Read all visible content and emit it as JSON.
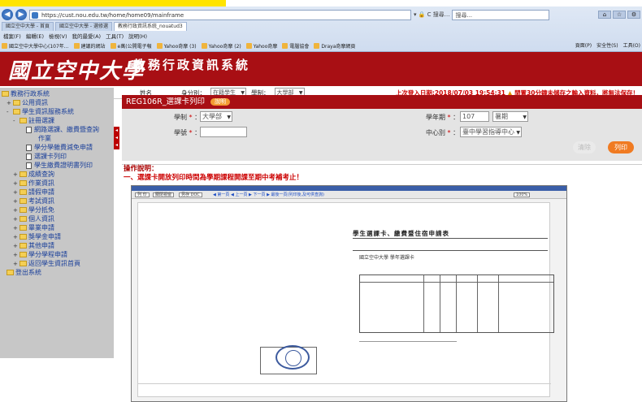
{
  "browser": {
    "address": "https://cust.nou.edu.tw/home/home09/mainframe",
    "address_tools": "▾ 🔒 C  搜尋...",
    "search_placeholder": "搜尋...",
    "tabs": [
      "國立空中大學 - 首頁",
      "國立空中大學 - 選修選",
      "教務行政資訊系統_nouatud3"
    ],
    "menu": [
      "檔案(F)",
      "編輯(E)",
      "檢視(V)",
      "我的最愛(A)",
      "工具(T)",
      "說明(H)"
    ],
    "favorites": [
      "國立空中大學中心(107年...",
      "建議的網站",
      "e萬(公開電子報",
      "Yahoo奇摩 (3)",
      "Yahoo奇摩 (2)",
      "Yahoo奇摩",
      "電腦協會",
      "Draya奇摩網頁"
    ],
    "fav_tools": [
      "頁面(P)",
      "安全性(S)",
      "工具(O)"
    ]
  },
  "header": {
    "logo": "國立空中大學",
    "system_title": "教務行政資訊系統",
    "name_label": "姓名",
    "identity_label": "身分別：",
    "identity_value": "在籍學生",
    "school_label": "學制：",
    "school_value": "大學部",
    "login_info": "上次登入日期:2018/07/03 19:54:31",
    "warning": "閒置30分鐘未儲存之輸入資料，將無法保存！"
  },
  "sidebar": {
    "items": [
      {
        "label": "教務行政系統",
        "level": 0,
        "kind": "folder",
        "expander": ""
      },
      {
        "label": "公用資訊",
        "level": 1,
        "kind": "folder",
        "expander": "+"
      },
      {
        "label": "學生資訊服務系統",
        "level": 1,
        "kind": "folder",
        "expander": "-"
      },
      {
        "label": "註冊選課",
        "level": 2,
        "kind": "folder",
        "expander": "-"
      },
      {
        "label": "網路選課、繳費暨查詢",
        "level": 3,
        "kind": "doc",
        "expander": ""
      },
      {
        "label": "作業",
        "level": 4,
        "kind": "none",
        "expander": ""
      },
      {
        "label": "學分學雜費減免申請",
        "level": 3,
        "kind": "doc",
        "expander": ""
      },
      {
        "label": "選課卡列印",
        "level": 3,
        "kind": "doc",
        "expander": ""
      },
      {
        "label": "學生繳費證明書列印",
        "level": 3,
        "kind": "doc",
        "expander": ""
      },
      {
        "label": "成績查詢",
        "level": 2,
        "kind": "folder",
        "expander": "+"
      },
      {
        "label": "作業資訊",
        "level": 2,
        "kind": "folder",
        "expander": "+"
      },
      {
        "label": "請假申請",
        "level": 2,
        "kind": "folder",
        "expander": "+"
      },
      {
        "label": "考試資訊",
        "level": 2,
        "kind": "folder",
        "expander": "+"
      },
      {
        "label": "學分抵免",
        "level": 2,
        "kind": "folder",
        "expander": "+"
      },
      {
        "label": "個人資訊",
        "level": 2,
        "kind": "folder",
        "expander": "+"
      },
      {
        "label": "畢業申請",
        "level": 2,
        "kind": "folder",
        "expander": "+"
      },
      {
        "label": "獎學金申請",
        "level": 2,
        "kind": "folder",
        "expander": "+"
      },
      {
        "label": "其他申請",
        "level": 2,
        "kind": "folder",
        "expander": "+"
      },
      {
        "label": "學分學程申請",
        "level": 2,
        "kind": "folder",
        "expander": "+"
      },
      {
        "label": "返回學生資訊首頁",
        "level": 2,
        "kind": "folder",
        "expander": "+"
      },
      {
        "label": "登出系統",
        "level": 1,
        "kind": "folder",
        "expander": ""
      }
    ]
  },
  "main": {
    "title": "REG106R_選課卡列印",
    "title_tag": "說明",
    "school_label": "學制",
    "school_value": "大學部",
    "student_no_label": "學號",
    "year_label": "學年期",
    "year_value": "107",
    "term_value": "暑期",
    "center_label": "中心別",
    "center_value": "臺中學習指導中心",
    "btn_clear": "清除",
    "btn_print": "列印",
    "instr_title": "操作說明：",
    "instr_text": "一、選課卡開放列印時間為學期課程開課至期中考補考止！"
  },
  "shot": {
    "toolbar": [
      "列 印",
      "關閉視窗",
      "另存 DOC"
    ],
    "link": "◀ 第一頁 ◀ 上一頁 ▶ 下一頁 ▶ 最後一頁(列印後,及可供查詢)",
    "zoom": "100%",
    "doc_title": "學生選課卡、繳費暨住宿申請表",
    "school_heading": "國立空中大學 學年選課卡"
  },
  "icons": [
    "back-icon",
    "forward-icon",
    "home-icon",
    "star-icon",
    "gear-icon",
    "folder-icon",
    "document-icon",
    "warning-icon"
  ]
}
